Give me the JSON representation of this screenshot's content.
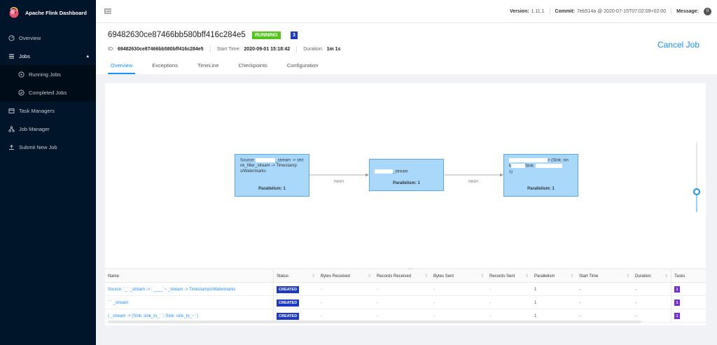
{
  "sidebar": {
    "brand": "Apache Flink Dashboard",
    "items": [
      {
        "label": "Overview"
      },
      {
        "label": "Jobs"
      },
      {
        "label": "Running Jobs"
      },
      {
        "label": "Completed Jobs"
      },
      {
        "label": "Task Managers"
      },
      {
        "label": "Job Manager"
      },
      {
        "label": "Submit New Job"
      }
    ]
  },
  "topbar": {
    "version_label": "Version:",
    "version": "1.11.1",
    "commit_label": "Commit:",
    "commit": "7eb514a @ 2020-07-15T07:02:09+02:00",
    "message_label": "Message:",
    "message_count": "0"
  },
  "job": {
    "title": "69482630ce87466bb580bff416c284e5",
    "status": "RUNNING",
    "task_count": "3",
    "cancel_label": "Cancel Job",
    "id_label": "ID:",
    "id": "69482630ce87466bb580bff416c284e5",
    "start_label": "Start Time:",
    "start": "2020-09-01 15:18:42",
    "duration_label": "Duration:",
    "duration": "1m 1s"
  },
  "tabs": [
    {
      "label": "Overview"
    },
    {
      "label": "Exceptions"
    },
    {
      "label": "TimeLine"
    },
    {
      "label": "Checkpoints"
    },
    {
      "label": "Configuration"
    }
  ],
  "graph": {
    "nodes": [
      {
        "line1_a": "Source: ",
        "line1_b": "_stream -> shri",
        "line2": "nk_filter_stream -> Timestamp",
        "line3": "s/Watermarks",
        "parallelism": "Parallelism: 1"
      },
      {
        "line1_b": "_stream",
        "parallelism": "Parallelism: 1"
      },
      {
        "line1_b": "> (Sink: sin",
        "line2_a": "k",
        "line2_b": "Sink: ",
        "line3": "s)",
        "parallelism": "Parallelism: 1"
      }
    ],
    "edges": [
      {
        "label": "HASH"
      },
      {
        "label": "HASH"
      }
    ]
  },
  "table": {
    "headers": [
      "Name",
      "Status",
      "Bytes Received",
      "Records Received",
      "Bytes Sent",
      "Records Sent",
      "Parallelism",
      "Start Time",
      "Duration",
      "Tasks"
    ],
    "rows": [
      {
        "name": "Source:  `_`  _stream -> :  ____`~  _stream -> Timestamps/Watermarks",
        "status": "CREATED",
        "bytes_received": "-",
        "records_received": "-",
        "bytes_sent": "-",
        "records_sent": "-",
        "parallelism": "1",
        "start_time": "-",
        "duration": "-",
        "tasks": "1"
      },
      {
        "name": "`  `  _stream",
        "status": "CREATED",
        "bytes_received": "-",
        "records_received": "-",
        "bytes_sent": "-",
        "records_sent": "-",
        "parallelism": "1",
        "start_time": "-",
        "duration": "-",
        "tasks": "1"
      },
      {
        "name": "(   _stream -> (Sink: sink_to_`  `, Sink: sink_to_~  `)",
        "status": "CREATED",
        "bytes_received": "-",
        "records_received": "-",
        "bytes_sent": "-",
        "records_sent": "-",
        "parallelism": "1",
        "start_time": "-",
        "duration": "-",
        "tasks": "1"
      }
    ]
  }
}
